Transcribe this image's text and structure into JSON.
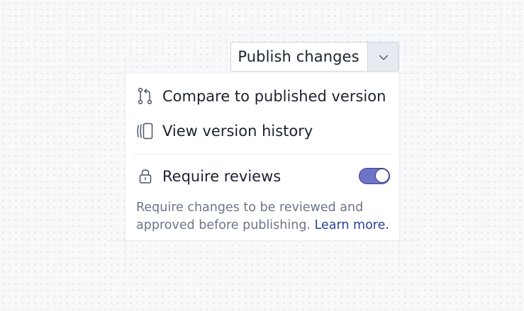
{
  "split_button": {
    "label": "Publish changes",
    "caret_icon": "chevron-down-icon"
  },
  "menu": {
    "items": [
      {
        "label": "Compare to published version",
        "icon": "compare-branches-icon"
      },
      {
        "label": "View version history",
        "icon": "version-history-icon"
      }
    ],
    "require_reviews": {
      "label": "Require reviews",
      "icon": "lock-icon",
      "enabled": true
    },
    "description": {
      "text": "Require changes to be reviewed and approved before publishing.",
      "link_label": "Learn more."
    }
  },
  "colors": {
    "toggle_on": "#6d74c6",
    "toggle_border": "#3d3f8f",
    "link": "#2a3e93",
    "muted_text": "#6b7685"
  }
}
